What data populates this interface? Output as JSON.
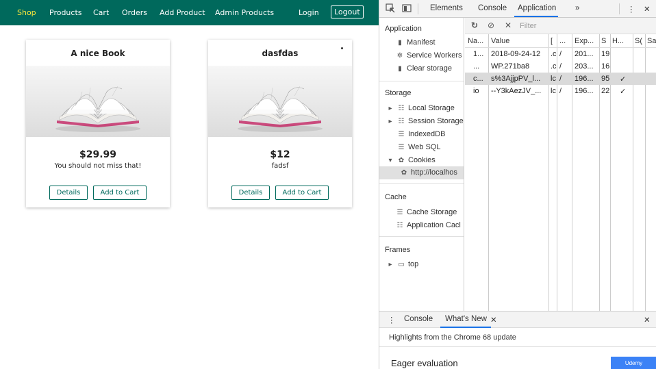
{
  "shop": {
    "nav": {
      "shop": "Shop",
      "products": "Products",
      "cart": "Cart",
      "orders": "Orders",
      "add_product": "Add Product",
      "admin_products": "Admin Products",
      "login": "Login",
      "logout": "Logout"
    },
    "products": [
      {
        "title": "A nice Book",
        "price": "$29.99",
        "description": "You should not miss that!",
        "details_label": "Details",
        "add_to_cart_label": "Add to Cart"
      },
      {
        "title": "dasfdas",
        "price": "$12",
        "description": "fadsf",
        "details_label": "Details",
        "add_to_cart_label": "Add to Cart"
      }
    ]
  },
  "devtools": {
    "tabs": {
      "elements": "Elements",
      "console": "Console",
      "application": "Application",
      "more": "»"
    },
    "sidebar": {
      "application_heading": "Application",
      "manifest": "Manifest",
      "service_workers": "Service Workers",
      "clear_storage": "Clear storage",
      "storage_heading": "Storage",
      "local_storage": "Local Storage",
      "session_storage": "Session Storage",
      "indexeddb": "IndexedDB",
      "web_sql": "Web SQL",
      "cookies": "Cookies",
      "cookie_origin": "http://localhos",
      "cache_heading": "Cache",
      "cache_storage": "Cache Storage",
      "application_cache": "Application Cacl",
      "frames_heading": "Frames",
      "top": "top"
    },
    "filter": {
      "placeholder": "Filter"
    },
    "cookie_table": {
      "headers": [
        "Na...",
        "Value",
        "[",
        "...",
        "Exp...",
        "S",
        "H...",
        "S(",
        "Sa"
      ],
      "rows": [
        [
          "1...",
          "2018-09-24-12",
          ".c",
          "/",
          "201...",
          "19",
          "",
          "",
          ""
        ],
        [
          "...",
          "WP.271ba8",
          ".c",
          "/",
          "203...",
          "16",
          "",
          "",
          ""
        ],
        [
          "c...",
          "s%3AjjpPV_l...",
          "lc",
          "/",
          "196...",
          "95",
          "✓",
          "",
          ""
        ],
        [
          "io",
          "--Y3kAezJV_...",
          "lc",
          "/",
          "196...",
          "22",
          "✓",
          "",
          ""
        ]
      ],
      "selected_row": 2
    },
    "drawer": {
      "console_tab": "Console",
      "whats_new_tab": "What's New",
      "highlights": "Highlights from the Chrome 68 update",
      "eager": "Eager evaluation",
      "badge": "Udemy"
    }
  },
  "colors": {
    "nav_bg": "#00695c",
    "active_nav": "#ffeb3b",
    "button_border": "#00695c",
    "devtools_accent": "#1a73e8"
  }
}
